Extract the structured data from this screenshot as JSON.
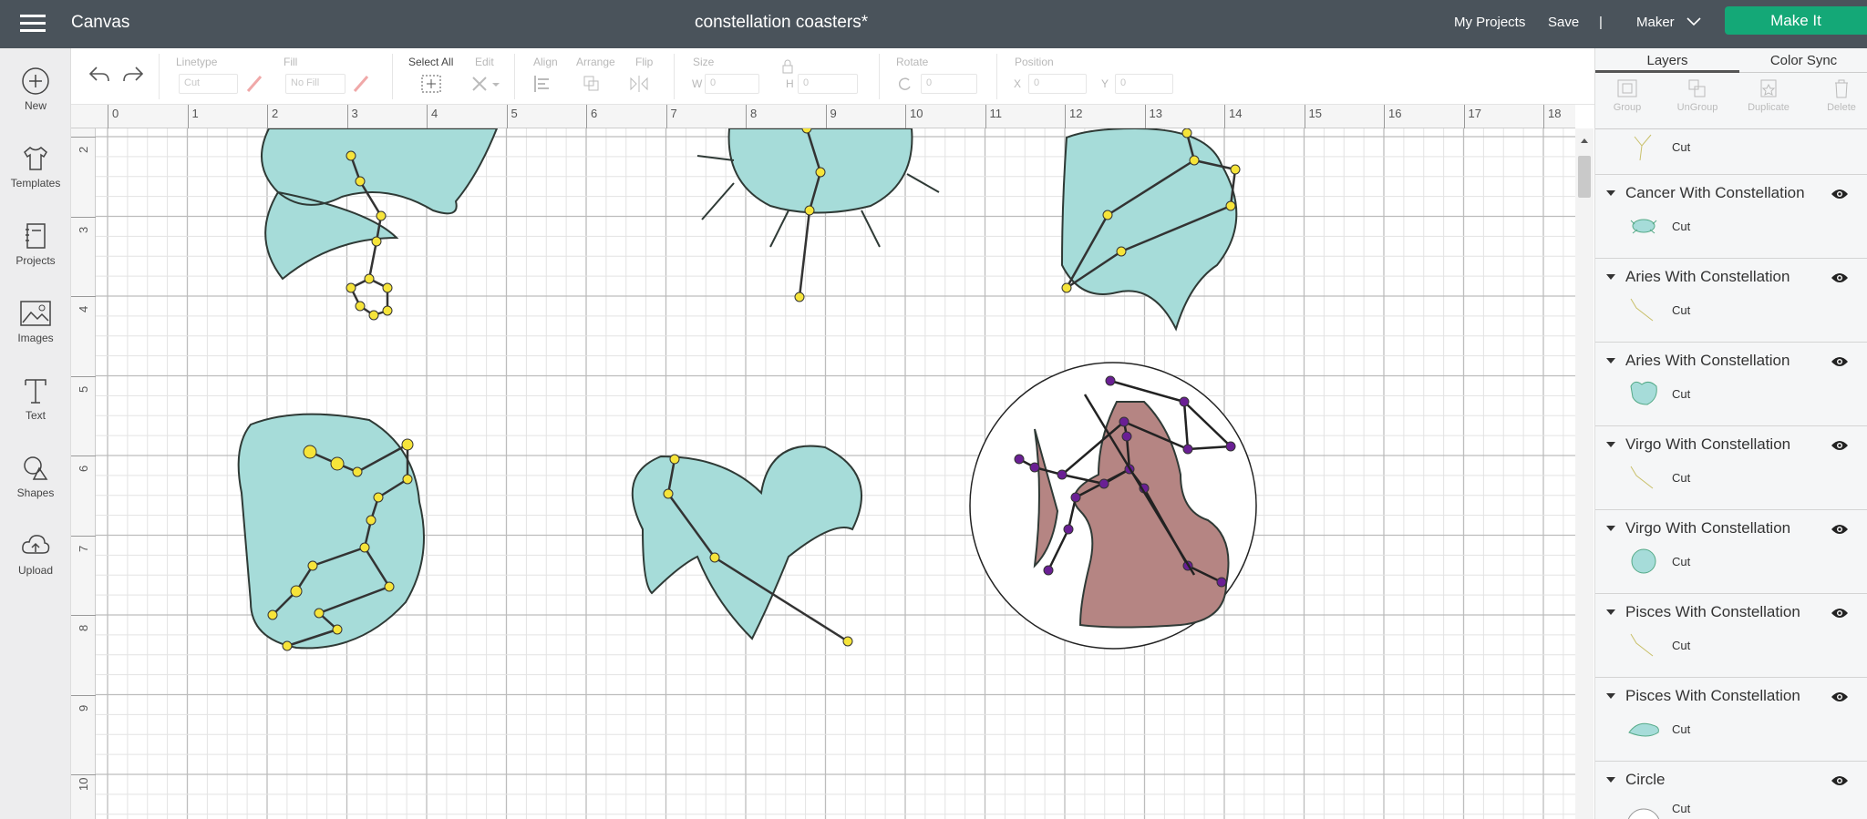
{
  "topbar": {
    "menu_icon": "hamburger-icon",
    "app": "Canvas",
    "title": "constellation coasters*",
    "my_projects": "My Projects",
    "save": "Save",
    "divider": "|",
    "machine": "Maker",
    "make_it": "Make It",
    "accent": "#14a877"
  },
  "sidebar": {
    "items": [
      {
        "label": "New",
        "icon": "plus-circle-icon"
      },
      {
        "label": "Templates",
        "icon": "shirt-icon"
      },
      {
        "label": "Projects",
        "icon": "notebook-icon"
      },
      {
        "label": "Images",
        "icon": "image-icon"
      },
      {
        "label": "Text",
        "icon": "text-icon"
      },
      {
        "label": "Shapes",
        "icon": "shapes-icon"
      },
      {
        "label": "Upload",
        "icon": "cloud-upload-icon"
      }
    ]
  },
  "toolbar": {
    "linetype": "Linetype",
    "linetype_value": "Cut",
    "fill": "Fill",
    "fill_value": "No Fill",
    "select_all": "Select All",
    "edit": "Edit",
    "align": "Align",
    "arrange": "Arrange",
    "flip": "Flip",
    "size": "Size",
    "w": "W",
    "w_value": "0",
    "h": "H",
    "h_value": "0",
    "rotate": "Rotate",
    "rotate_value": "0",
    "position": "Position",
    "x": "X",
    "x_value": "0",
    "y": "Y",
    "y_value": "0"
  },
  "ruler": {
    "horizontal": [
      "0",
      "1",
      "2",
      "3",
      "4",
      "5",
      "6",
      "7",
      "8",
      "9",
      "10",
      "11",
      "12",
      "13",
      "14",
      "15",
      "16",
      "17",
      "18"
    ],
    "vertical": [
      "2",
      "3",
      "4",
      "5",
      "6",
      "7",
      "8",
      "9",
      "10"
    ]
  },
  "panel": {
    "tabs": [
      "Layers",
      "Color Sync"
    ],
    "actions": [
      "Group",
      "UnGroup",
      "Duplicate",
      "Delete"
    ],
    "partial_layer": {
      "cut": "Cut"
    },
    "layers": [
      {
        "name": "Cancer With Constellation",
        "op": "Cut",
        "thumb": "crab"
      },
      {
        "name": "Aries With Constellation",
        "op": "Cut",
        "thumb": "line"
      },
      {
        "name": "Aries With Constellation",
        "op": "Cut",
        "thumb": "ram"
      },
      {
        "name": "Virgo With Constellation",
        "op": "Cut",
        "thumb": "line"
      },
      {
        "name": "Virgo With Constellation",
        "op": "Cut",
        "thumb": "virgo"
      },
      {
        "name": "Pisces With Constellation",
        "op": "Cut",
        "thumb": "line"
      },
      {
        "name": "Pisces With Constellation",
        "op": "Cut",
        "thumb": "fish"
      },
      {
        "name": "Circle",
        "op": "Cut",
        "thumb": "circle"
      }
    ]
  },
  "colors": {
    "teal": "#a6dcd9",
    "star": "#f6e43a",
    "sagittarius": "#b58583",
    "purple_star": "#6a1f94"
  }
}
